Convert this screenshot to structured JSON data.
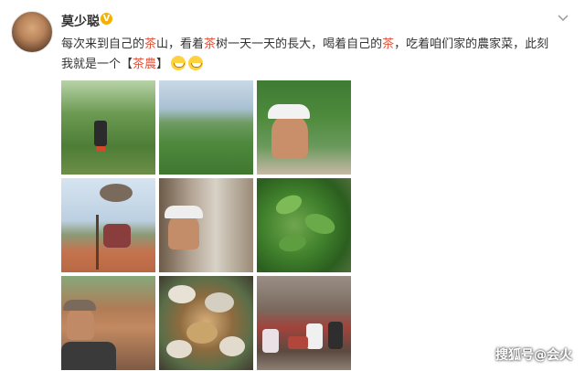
{
  "post": {
    "username": "莫少聪",
    "verified_badge": "V",
    "text_segments": [
      {
        "t": "每次来到自己的",
        "tag": false
      },
      {
        "t": "茶",
        "tag": true
      },
      {
        "t": "山，看着",
        "tag": false
      },
      {
        "t": "茶",
        "tag": true
      },
      {
        "t": "树一天一天的長大，喝着自己的",
        "tag": false
      },
      {
        "t": "茶",
        "tag": true
      },
      {
        "t": "，吃着咱们家的農家菜，此刻",
        "tag": false
      },
      {
        "t": "我就是一个【",
        "tag": false
      },
      {
        "t": "茶農",
        "tag": true
      },
      {
        "t": "】",
        "tag": false
      }
    ],
    "emojis": [
      "grin-emoji",
      "grin-emoji"
    ],
    "photos_count": 9
  },
  "watermark": "搜狐号@会火",
  "colors": {
    "tag": "#e2533b",
    "badge": "#f6b100",
    "text": "#333333"
  }
}
